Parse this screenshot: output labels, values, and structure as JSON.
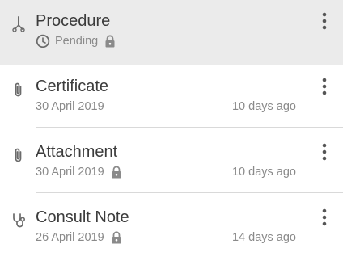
{
  "items": [
    {
      "title": "Procedure",
      "status": "Pending",
      "icon": "scalpel-icon",
      "locked": true
    },
    {
      "title": "Certificate",
      "date": "30 April 2019",
      "ago": "10 days ago",
      "icon": "paperclip-icon",
      "locked": false
    },
    {
      "title": "Attachment",
      "date": "30 April 2019",
      "ago": "10 days ago",
      "icon": "paperclip-icon",
      "locked": true
    },
    {
      "title": "Consult Note",
      "date": "26 April 2019",
      "ago": "14 days ago",
      "icon": "stethoscope-icon",
      "locked": true
    }
  ],
  "colors": {
    "selected_background": "#ebebeb",
    "title_text": "#3c3c3c",
    "secondary_text": "#8a8a8a",
    "icon": "#6b6b6b",
    "divider": "#d9d9d9"
  }
}
